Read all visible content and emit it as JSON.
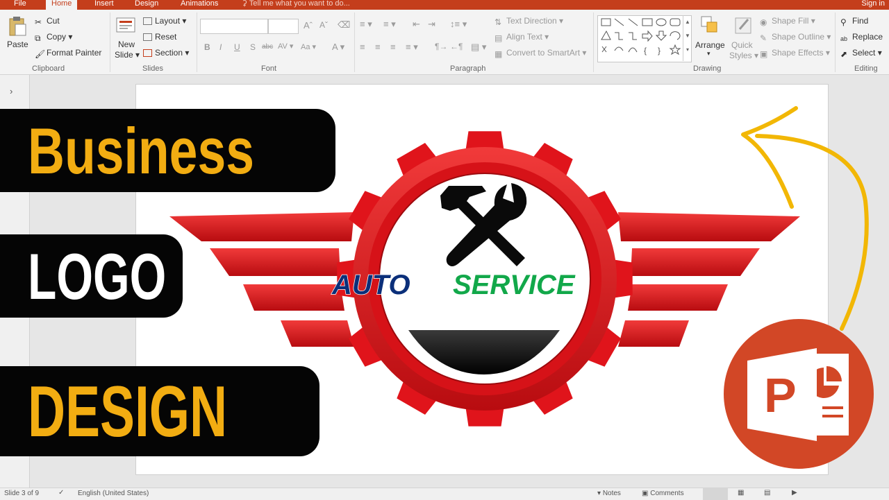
{
  "tabs": {
    "file": "File",
    "home": "Home",
    "insert": "Insert",
    "design": "Design",
    "animations": "Animations",
    "tell_me": "Tell me what you want to do...",
    "sign_in": "Sign in"
  },
  "ribbon": {
    "clipboard": {
      "paste": "Paste",
      "cut": "Cut",
      "copy": "Copy",
      "format_painter": "Format Painter",
      "label": "Clipboard"
    },
    "slides": {
      "new_slide_1": "New",
      "new_slide_2": "Slide",
      "layout": "Layout",
      "reset": "Reset",
      "section": "Section",
      "label": "Slides"
    },
    "font": {
      "bold": "B",
      "italic": "I",
      "underline": "U",
      "shadow": "S",
      "strike": "abc",
      "spacing": "AV",
      "case": "Aa",
      "color": "A",
      "label": "Font"
    },
    "paragraph": {
      "text_direction": "Text Direction",
      "align_text": "Align Text",
      "convert_smartart": "Convert to SmartArt",
      "label": "Paragraph"
    },
    "drawing": {
      "arrange": "Arrange",
      "quick_styles_1": "Quick",
      "quick_styles_2": "Styles",
      "shape_fill": "Shape Fill",
      "shape_outline": "Shape Outline",
      "shape_effects": "Shape Effects",
      "label": "Drawing"
    },
    "editing": {
      "find": "Find",
      "replace": "Replace",
      "select": "Select",
      "label": "Editing"
    }
  },
  "banners": {
    "line1": "Business",
    "line2": "LOGO",
    "line3": "DESIGN"
  },
  "logo": {
    "word1": "AUTO",
    "word2": "SERVICE",
    "word1_color": "#0b2f7a",
    "word2_color": "#12a84a",
    "gear_color": "#e0141b"
  },
  "app_icon": {
    "letter": "P",
    "color": "#d24726"
  },
  "arrow_color": "#f2b705",
  "status": {
    "slide": "Slide 3 of 9",
    "language": "English (United States)",
    "notes": "Notes",
    "comments": "Comments"
  }
}
